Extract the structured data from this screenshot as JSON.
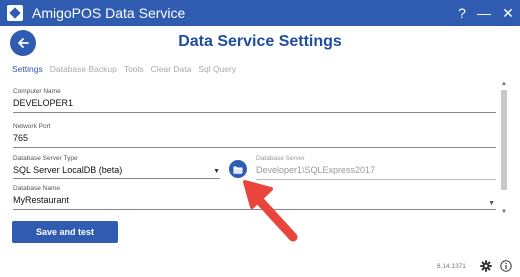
{
  "window": {
    "title": "AmigoPOS Data Service",
    "help_label": "?",
    "minimize_label": "—",
    "close_label": "✕"
  },
  "page": {
    "title": "Data Service Settings",
    "back_icon": "back-arrow-icon"
  },
  "tabs": [
    {
      "label": "Settings",
      "active": true
    },
    {
      "label": "Database Backup",
      "active": false
    },
    {
      "label": "Tools",
      "active": false
    },
    {
      "label": "Clear Data",
      "active": false
    },
    {
      "label": "Sql Query",
      "active": false
    }
  ],
  "fields": {
    "computer_name": {
      "label": "Computer Name",
      "value": "DEVELOPER1"
    },
    "network_port": {
      "label": "Network Port",
      "value": "765"
    },
    "server_type": {
      "label": "Database Server Type",
      "value": "SQL Server LocalDB (beta)"
    },
    "database_server": {
      "label": "Database Server",
      "value": "Developer1\\SQLExpress2017"
    },
    "database_name": {
      "label": "Database Name",
      "value": "MyRestaurant"
    }
  },
  "buttons": {
    "save_and_test": "Save and test"
  },
  "footer": {
    "version": "8.14.1371"
  },
  "colors": {
    "brand_blue": "#2f5bb0",
    "annotation_red": "#e8453c"
  }
}
